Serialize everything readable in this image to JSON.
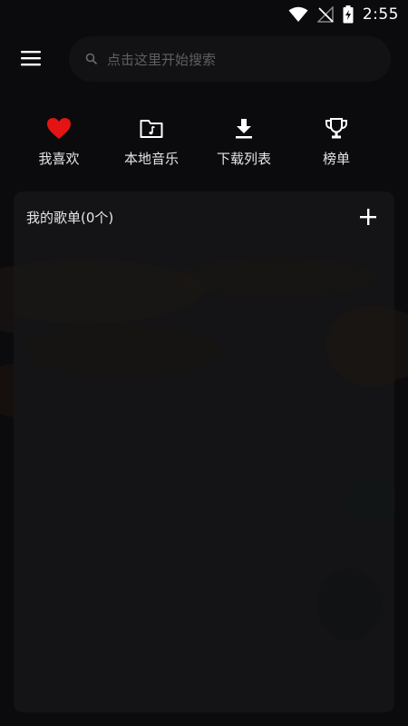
{
  "status_bar": {
    "time": "2:55"
  },
  "search": {
    "placeholder": "点击这里开始搜索"
  },
  "quick_actions": [
    {
      "label": "我喜欢",
      "icon": "heart-icon"
    },
    {
      "label": "本地音乐",
      "icon": "music-folder-icon"
    },
    {
      "label": "下载列表",
      "icon": "download-icon"
    },
    {
      "label": "榜单",
      "icon": "trophy-icon"
    }
  ],
  "playlist": {
    "title": "我的歌单(0个)"
  },
  "colors": {
    "background": "#0b0b0d",
    "card": "#141416",
    "heart": "#e41414",
    "search_bg": "#121214"
  }
}
